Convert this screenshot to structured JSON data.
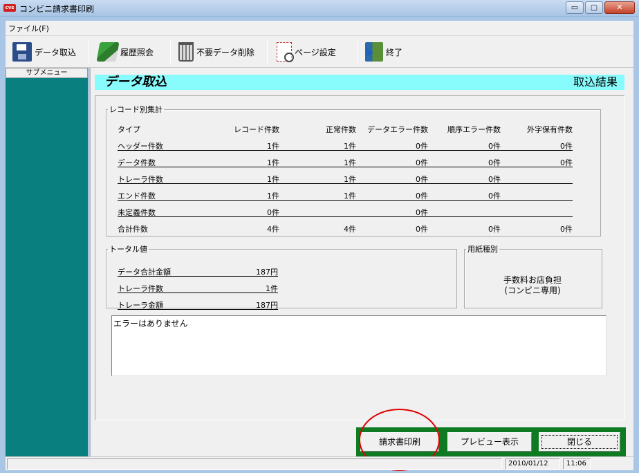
{
  "window": {
    "app_icon_text": "cvs",
    "title": "コンビニ請求書印刷",
    "minimize": "▭",
    "maximize": "▢",
    "close": "✕"
  },
  "menu": {
    "file": "ファイル(F)"
  },
  "toolbar": {
    "import": "データ取込",
    "history": "履歴照会",
    "delete": "不要データ削除",
    "page_setup": "ページ設定",
    "exit": "終了"
  },
  "sidebar": {
    "header": "サブメニュー"
  },
  "main": {
    "title": "データ取込",
    "result_label": "取込結果"
  },
  "record_summary": {
    "legend": "レコード別集計",
    "headers": [
      "タイプ",
      "レコード件数",
      "正常件数",
      "データエラー件数",
      "順序エラー件数",
      "外字保有件数"
    ],
    "rows": [
      [
        "ヘッダー件数",
        "1件",
        "1件",
        "0件",
        "0件",
        "0件"
      ],
      [
        "データ件数",
        "1件",
        "1件",
        "0件",
        "0件",
        "0件"
      ],
      [
        "トレーラ件数",
        "1件",
        "1件",
        "0件",
        "0件",
        ""
      ],
      [
        "エンド件数",
        "1件",
        "1件",
        "0件",
        "0件",
        ""
      ],
      [
        "未定義件数",
        "0件",
        "",
        "0件",
        "",
        ""
      ],
      [
        "合計件数",
        "4件",
        "4件",
        "0件",
        "0件",
        "0件"
      ]
    ]
  },
  "totals": {
    "legend": "トータル値",
    "rows": [
      [
        "データ合計金額",
        "187円"
      ],
      [
        "トレーラ件数",
        "1件"
      ],
      [
        "トレーラ金額",
        "187円"
      ]
    ]
  },
  "paper_type": {
    "legend": "用紙種別",
    "line1": "手数料お店負担",
    "line2": "(コンビニ専用)"
  },
  "error_message": "エラーはありません",
  "buttons": {
    "print_invoice": "請求書印刷",
    "preview": "プレビュー表示",
    "close": "閉じる"
  },
  "status": {
    "message": "",
    "date": "2010/01/12",
    "time": "11:06"
  },
  "colors": {
    "sidebar": "#0a7f80",
    "banner": "#88fcfc",
    "button_bar": "#0e7a22",
    "highlight_ring": "#e00000"
  }
}
